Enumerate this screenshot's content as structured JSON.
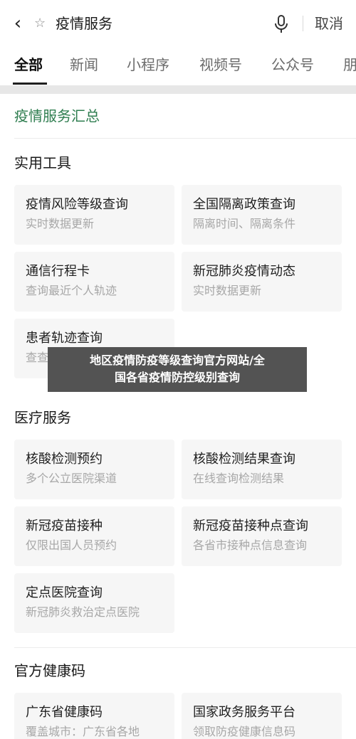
{
  "search_bar": {
    "query": "疫情服务",
    "cancel_label": "取消"
  },
  "tabs": [
    {
      "label": "全部"
    },
    {
      "label": "新闻"
    },
    {
      "label": "小程序"
    },
    {
      "label": "视频号"
    },
    {
      "label": "公众号"
    },
    {
      "label": "朋"
    }
  ],
  "summary": {
    "title": "疫情服务汇总"
  },
  "sections": [
    {
      "title": "实用工具",
      "cards": [
        {
          "title": "疫情风险等级查询",
          "subtitle": "实时数据更新"
        },
        {
          "title": "全国隔离政策查询",
          "subtitle": "隔离时间、隔离条件"
        },
        {
          "title": "通信行程卡",
          "subtitle": "查询最近个人轨迹"
        },
        {
          "title": "新冠肺炎疫情动态",
          "subtitle": "实时数据更新"
        },
        {
          "title": "患者轨迹查询",
          "subtitle": "查查"
        }
      ]
    },
    {
      "title": "医疗服务",
      "cards": [
        {
          "title": "核酸检测预约",
          "subtitle": "多个公立医院渠道"
        },
        {
          "title": "核酸检测结果查询",
          "subtitle": "在线查询检测结果"
        },
        {
          "title": "新冠疫苗接种",
          "subtitle": "仅限出国人员预约"
        },
        {
          "title": "新冠疫苗接种点查询",
          "subtitle": "各省市接种点信息查询"
        },
        {
          "title": "定点医院查询",
          "subtitle": "新冠肺炎救治定点医院"
        }
      ]
    },
    {
      "title": "官方健康码",
      "cards": [
        {
          "title": "广东省健康码",
          "subtitle": "覆盖城市：广东省各地"
        },
        {
          "title": "国家政务服务平台",
          "subtitle": "领取防疫健康信息码"
        }
      ]
    }
  ],
  "overlay": {
    "line1": "地区疫情防疫等级查询官方网站/全",
    "line2": "国各省疫情防控级别查询"
  },
  "colors": {
    "accent_green": "#2e7d4f",
    "overlay_bg": "#464646"
  }
}
